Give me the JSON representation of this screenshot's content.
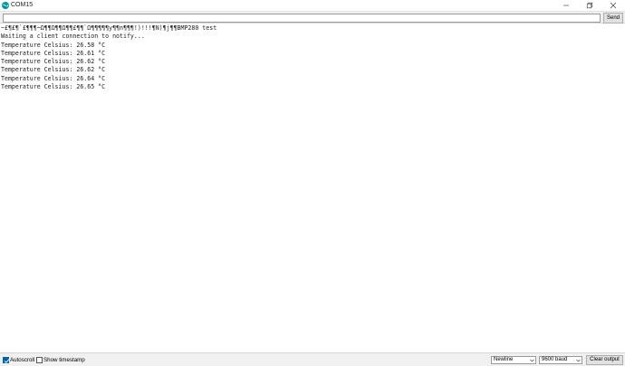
{
  "window": {
    "title": "COM15",
    "icon": "arduino-icon"
  },
  "input_row": {
    "value": "",
    "placeholder": "",
    "send_label": "Send"
  },
  "output": {
    "lines": [
      "~£¶£¶`£¶¶¶~Ω¶¶Ω¶¶Ω¶¶£¶¶`Ω¶¶¶¶¶y¶¶n¶¶¶!)!!!¶N)¶j¶¶BMP280 test",
      "Waiting a client connection to notify...",
      "Temperature Celsius: 26.58 °C",
      "Temperature Celsius: 26.61 °C",
      "Temperature Celsius: 26.62 °C",
      "Temperature Celsius: 26.62 °C",
      "Temperature Celsius: 26.64 °C",
      "Temperature Celsius: 26.65 °C"
    ]
  },
  "statusbar": {
    "autoscroll_label": "Autoscroll",
    "autoscroll_checked": true,
    "timestamp_label": "Show timestamp",
    "timestamp_checked": false,
    "line_ending": "Newline",
    "baud_rate": "9600 baud",
    "clear_label": "Clear output"
  },
  "colors": {
    "accent": "#0063b1",
    "app_icon": "#00979d"
  }
}
